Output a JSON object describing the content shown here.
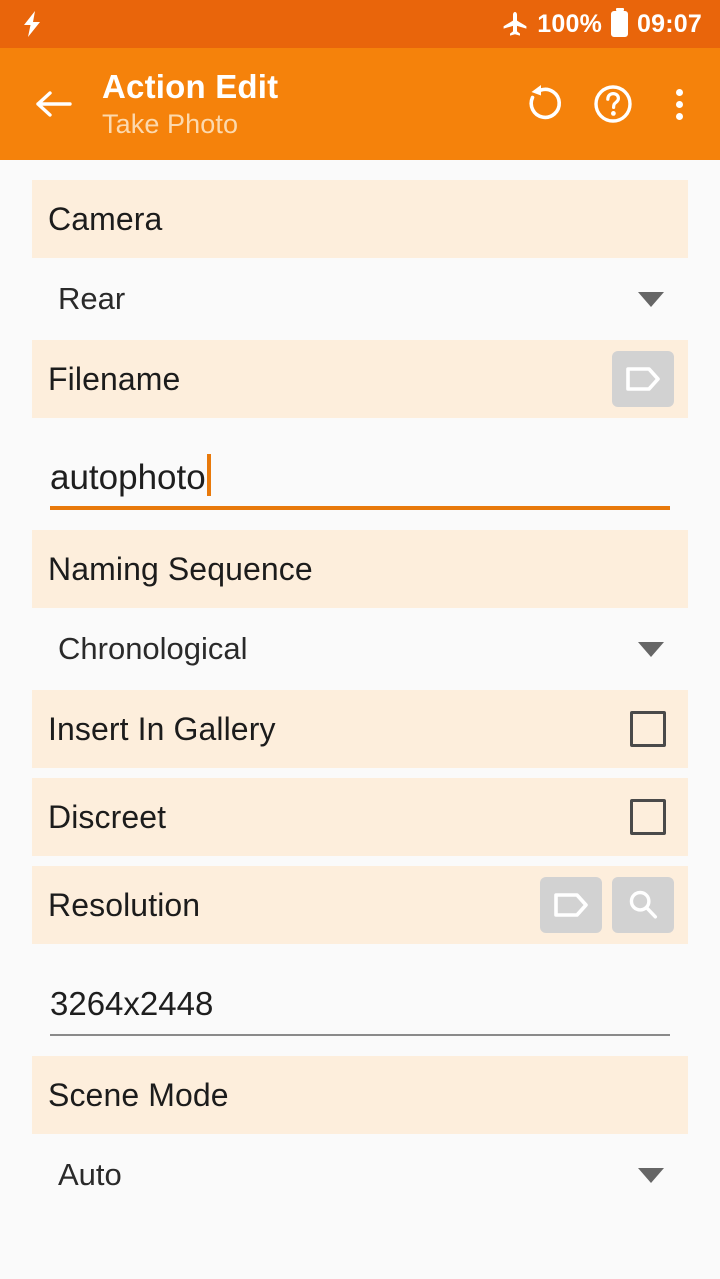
{
  "status_bar": {
    "left_icon": "lightning-bolt-icon",
    "airplane_icon": "airplane-mode-icon",
    "battery_percent": "100%",
    "battery_icon": "battery-full-icon",
    "time": "09:07",
    "background_color": "#E9650B"
  },
  "app_bar": {
    "back_icon": "back-arrow-icon",
    "title": "Action Edit",
    "subtitle": "Take Photo",
    "undo_icon": "undo-icon",
    "help_icon": "help-circle-icon",
    "overflow_icon": "overflow-menu-icon",
    "background_color": "#F5820B",
    "title_color": "#FFFFFF",
    "subtitle_color": "#FCD9AE"
  },
  "theme": {
    "section_header_bg": "#FDEEDC",
    "page_bg": "#FAFAFA",
    "accent": "#E8790B",
    "icon_chip_bg": "#D2D2D2"
  },
  "sections": {
    "camera": {
      "label": "Camera",
      "value": "Rear",
      "control": "dropdown"
    },
    "filename": {
      "label": "Filename",
      "tag_icon": "tag-icon",
      "value": "autophoto",
      "focused": true
    },
    "naming_sequence": {
      "label": "Naming Sequence",
      "value": "Chronological",
      "control": "dropdown"
    },
    "insert_in_gallery": {
      "label": "Insert In Gallery",
      "checked": false,
      "control": "checkbox"
    },
    "discreet": {
      "label": "Discreet",
      "checked": false,
      "control": "checkbox"
    },
    "resolution": {
      "label": "Resolution",
      "tag_icon": "tag-icon",
      "search_icon": "search-icon",
      "value": "3264x2448",
      "focused": false
    },
    "scene_mode": {
      "label": "Scene Mode",
      "value": "Auto",
      "control": "dropdown"
    }
  }
}
